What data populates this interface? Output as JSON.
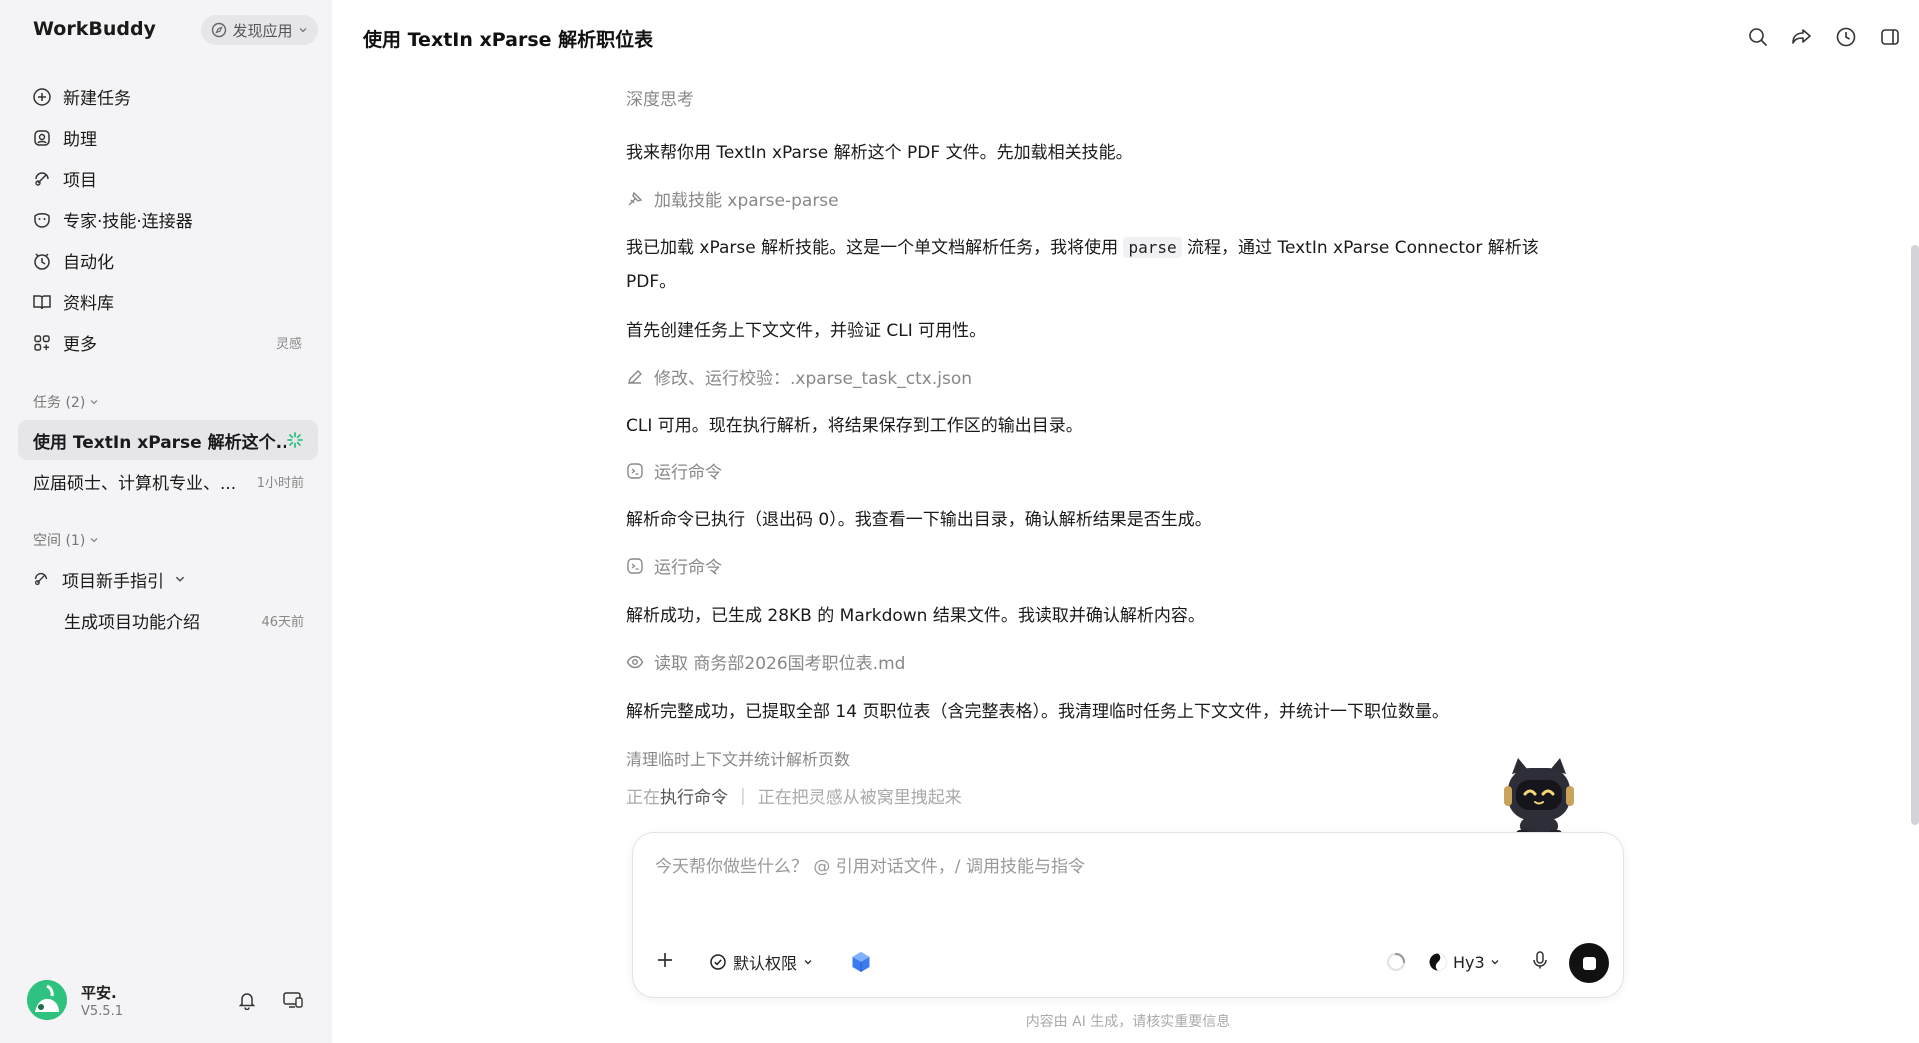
{
  "sidebar": {
    "brand": "WorkBuddy",
    "discover_label": "发现应用",
    "nav": [
      {
        "label": "新建任务",
        "icon": "plus-circle-icon"
      },
      {
        "label": "助理",
        "icon": "assistant-icon"
      },
      {
        "label": "项目",
        "icon": "project-icon"
      },
      {
        "label": "专家·技能·连接器",
        "icon": "expert-icon"
      },
      {
        "label": "自动化",
        "icon": "automation-icon"
      },
      {
        "label": "资料库",
        "icon": "book-icon"
      },
      {
        "label": "更多",
        "icon": "grid-icon",
        "badge": "灵感"
      }
    ],
    "tasks_section": "任务 (2)",
    "tasks": [
      {
        "label": "使用 TextIn xParse 解析这个...",
        "status": "running"
      },
      {
        "label": "应届硕士、计算机专业、...",
        "time": "1小时前"
      }
    ],
    "spaces_section": "空间 (1)",
    "space": {
      "label": "项目新手指引"
    },
    "space_items": [
      {
        "label": "生成项目功能介绍",
        "time": "46天前"
      }
    ],
    "user": {
      "name": "平安.",
      "version": "V5.5.1"
    }
  },
  "header": {
    "title": "使用 TextIn xParse 解析职位表"
  },
  "conversation": {
    "deep_thinking": "深度思考",
    "msg1": "我来帮你用 TextIn xParse 解析这个 PDF 文件。先加载相关技能。",
    "tool1": "加载技能 xparse-parse",
    "msg2_a": "我已加载 xParse 解析技能。这是一个单文档解析任务，我将使用 ",
    "msg2_code": "parse",
    "msg2_b": " 流程，通过 TextIn xParse Connector 解析该",
    "msg2_c": "PDF。",
    "msg3": "首先创建任务上下文文件，并验证 CLI 可用性。",
    "tool2": "修改、运行校验：.xparse_task_ctx.json",
    "msg4": "CLI 可用。现在执行解析，将结果保存到工作区的输出目录。",
    "tool3": "运行命令",
    "msg5": "解析命令已执行（退出码 0）。我查看一下输出目录，确认解析结果是否生成。",
    "tool4": "运行命令",
    "msg6": "解析成功，已生成 28KB 的 Markdown 结果文件。我读取并确认解析内容。",
    "tool5": "读取 商务部2026国考职位表.md",
    "msg7": "解析完整成功，已提取全部 14 页职位表（含完整表格）。我清理临时任务上下文文件，并统计一下职位数量。",
    "step": "清理临时上下文并统计解析页数",
    "status_a_pre": "正在",
    "status_a_bold": "执行命令",
    "status_sep": "|",
    "status_b": "正在把灵感从被窝里拽起来"
  },
  "composer": {
    "placeholder": "今天帮你做些什么？ @ 引用对话文件，/ 调用技能与指令",
    "permission": "默认权限",
    "model": "Hy3"
  },
  "disclaimer": "内容由 AI 生成，请核实重要信息",
  "colors": {
    "accent": "#2ec27e",
    "sidebar_bg": "#f4f4f6"
  }
}
